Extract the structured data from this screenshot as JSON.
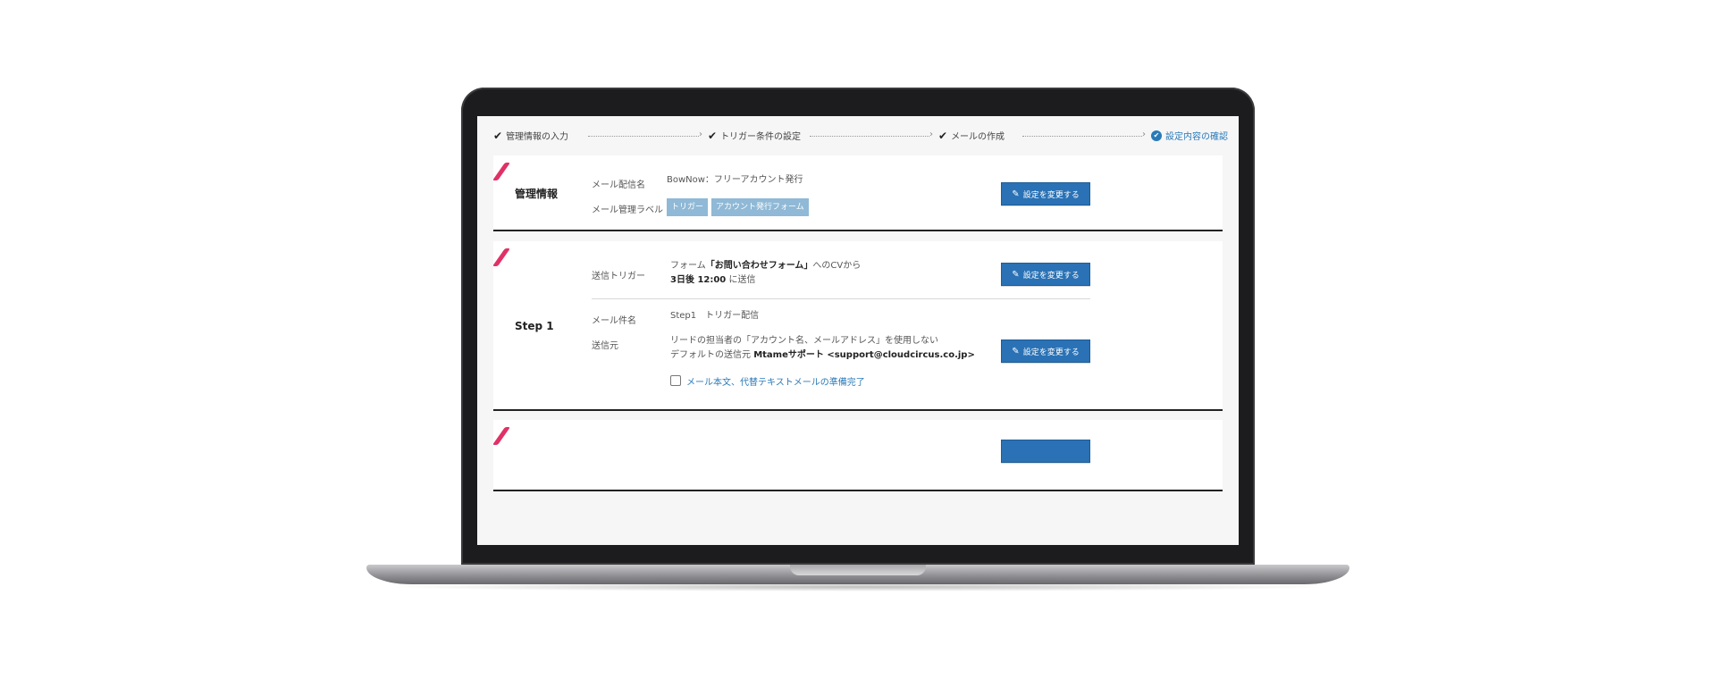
{
  "stepper": {
    "steps": [
      {
        "label": "管理情報の入力",
        "state": "done"
      },
      {
        "label": "トリガー条件の設定",
        "state": "done"
      },
      {
        "label": "メールの作成",
        "state": "done"
      },
      {
        "label": "設定内容の確認",
        "state": "active"
      }
    ]
  },
  "management": {
    "title": "管理情報",
    "mail_name_label": "メール配信名",
    "mail_name_value": "BowNow：フリーアカウント発行",
    "label_label": "メール管理ラベル",
    "tags": [
      "トリガー",
      "アカウント発行フォーム"
    ],
    "change_button": "設定を変更する"
  },
  "step1": {
    "title": "Step 1",
    "trigger_label": "送信トリガー",
    "trigger_line1_prefix": "フォーム",
    "trigger_line1_form": "「お問い合わせフォーム」",
    "trigger_line1_suffix": "へのCVから",
    "trigger_line2_bold": "3日後 12:00",
    "trigger_line2_suffix": "に送信",
    "trigger_change_button": "設定を変更する",
    "subject_label": "メール件名",
    "subject_value": "Step1　トリガー配信",
    "sender_label": "送信元",
    "sender_line1": "リードの担当者の「アカウント名、メールアドレス」を使用しない",
    "sender_line2_prefix": "デフォルトの送信元",
    "sender_line2_bold": "Mtameサポート <support@cloudcircus.co.jp>",
    "sender_change_button": "設定を変更する",
    "ready_checkbox_label": "メール本文、代替テキストメールの準備完了"
  },
  "colors": {
    "accent_blue": "#2a72b5",
    "tag_blue": "#8fb9d6",
    "stripe_pink": "#e03167"
  }
}
